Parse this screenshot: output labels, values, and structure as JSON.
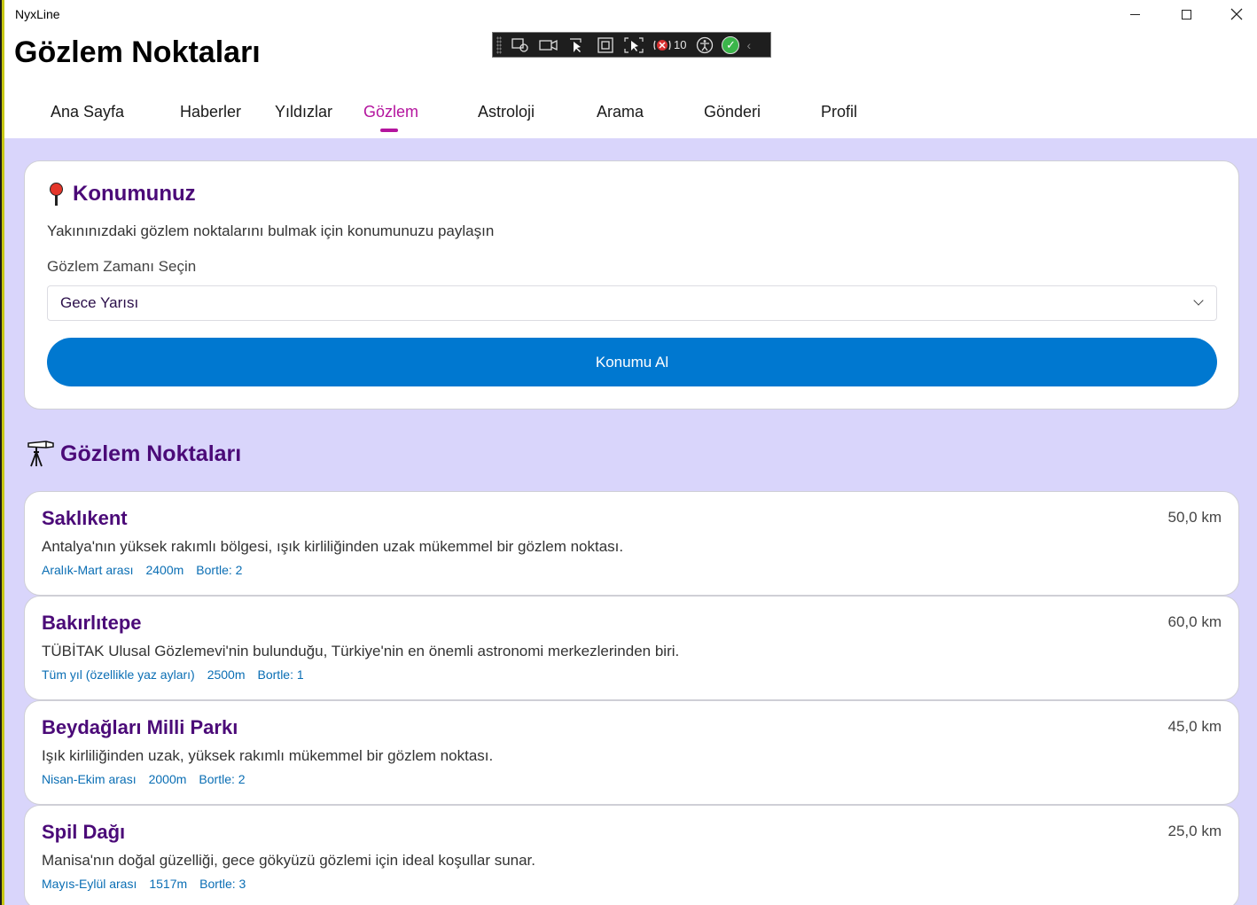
{
  "window": {
    "app_title": "NyxLine",
    "minimize_icon": "minimize-icon",
    "maximize_icon": "maximize-icon",
    "close_icon": "close-icon"
  },
  "devtools": {
    "icons": [
      "select-element-icon",
      "record-icon",
      "pointer-icon",
      "layout-bounds-icon",
      "track-focus-icon",
      "binding-failures-icon",
      "accessibility-icon",
      "checkmark-icon",
      "collapse-icon"
    ],
    "binding_failures_count": "10"
  },
  "header": {
    "title": "Gözlem Noktaları"
  },
  "nav": {
    "items": [
      {
        "label": "Ana Sayfa"
      },
      {
        "label": "Haberler"
      },
      {
        "label": "Yıldızlar"
      },
      {
        "label": "Gözlem"
      },
      {
        "label": "Astroloji"
      },
      {
        "label": "Arama"
      },
      {
        "label": "Gönderi"
      },
      {
        "label": "Profil"
      }
    ],
    "active": "Gözlem",
    "accent_color": "#b4159e"
  },
  "location": {
    "icon": "pin-icon",
    "title": "Konumunuz",
    "description": "Yakınınızdaki gözlem noktalarını bulmak için konumunuzu paylaşın",
    "time_label": "Gözlem Zamanı Seçin",
    "time_value": "Gece Yarısı",
    "button_label": "Konumu Al",
    "button_color": "#0078d0"
  },
  "spots_section": {
    "icon": "telescope-icon",
    "title": "Gözlem Noktaları",
    "items": [
      {
        "name": "Saklıkent",
        "distance": "50,0 km",
        "description": "Antalya'nın yüksek rakımlı bölgesi, ışık kirliliğinden uzak mükemmel bir gözlem noktası.",
        "season": "Aralık-Mart arası",
        "altitude": "2400m",
        "bortle": "Bortle: 2"
      },
      {
        "name": "Bakırlıtepe",
        "distance": "60,0 km",
        "description": "TÜBİTAK Ulusal Gözlemevi'nin bulunduğu, Türkiye'nin en önemli astronomi merkezlerinden biri.",
        "season": "Tüm yıl (özellikle yaz ayları)",
        "altitude": "2500m",
        "bortle": "Bortle: 1"
      },
      {
        "name": "Beydağları Milli Parkı",
        "distance": "45,0 km",
        "description": "Işık kirliliğinden uzak, yüksek rakımlı mükemmel bir gözlem noktası.",
        "season": "Nisan-Ekim arası",
        "altitude": "2000m",
        "bortle": "Bortle: 2"
      },
      {
        "name": "Spil Dağı",
        "distance": "25,0 km",
        "description": "Manisa'nın doğal güzelliği, gece gökyüzü gözlemi için ideal koşullar sunar.",
        "season": "Mayıs-Eylül arası",
        "altitude": "1517m",
        "bortle": "Bortle: 3"
      }
    ]
  },
  "colors": {
    "background": "#d9d5fb",
    "heading": "#4b0a78",
    "meta": "#0a6eb4"
  }
}
